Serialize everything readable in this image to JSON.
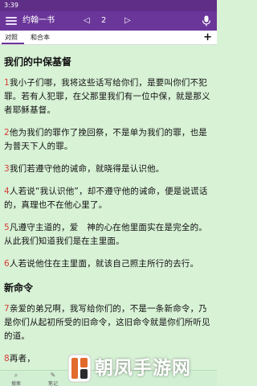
{
  "status": {
    "time": "3:39",
    "right": ""
  },
  "appbar": {
    "title": "约翰一书",
    "prev": "◁",
    "page": "2",
    "next": "▷"
  },
  "tabs": [
    {
      "label": "对照"
    },
    {
      "label": "和合本"
    }
  ],
  "plus": "+",
  "sections": [
    {
      "title": "我们的中保基督"
    }
  ],
  "verses": [
    {
      "num": "1",
      "text": "我小子们哪，我将这些话写给你们，是要叫你们不犯罪。若有人犯罪，在父那里我们有一位中保，就是那义者耶稣基督。"
    },
    {
      "num": "2",
      "text": "他为我们的罪作了挽回祭，不是单为我们的罪，也是为普天下人的罪。"
    },
    {
      "num": "3",
      "text": "我们若遵守他的诫命，就晓得是认识他。"
    },
    {
      "num": "4",
      "text": "人若说“我认识他”，却不遵守他的诫命，便是说谎话的，真理也不在他心里了。"
    },
    {
      "num": "5",
      "text": "凡遵守主道的，爱　神的心在他里面实在是完全的。从此我们知道我们是在主里面。"
    },
    {
      "num": "6",
      "text": "人若说他住在主里面，就该自己照主所行的去行。"
    }
  ],
  "section2": {
    "title": "新命令"
  },
  "verses2": [
    {
      "num": "7",
      "text": "亲爱的弟兄啊，我写给你们的，不是一条新命令，乃是你们从起初所受的旧命令，这旧命令就是你们所听见的道。"
    },
    {
      "num": "8",
      "text": "再者，"
    }
  ],
  "bottom_nav": [
    {
      "label": "搜索",
      "icon": "search-icon"
    },
    {
      "label": "笔记",
      "icon": "note-icon"
    }
  ],
  "watermark": {
    "text": "朝凤手游网"
  },
  "colors": {
    "status": "#5F2E86",
    "appbar": "#6A369A",
    "bg": "#D8F2D6",
    "verse_num": "#D4413A"
  }
}
